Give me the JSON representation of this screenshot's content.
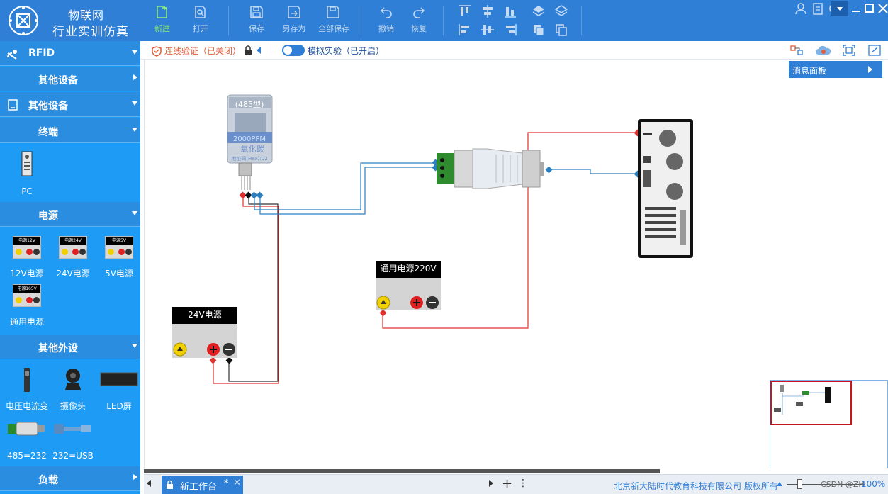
{
  "brand": {
    "line1": "物联网",
    "line2": "行业实训仿真"
  },
  "toolbar": {
    "new": "新建",
    "open": "打开",
    "save": "保存",
    "save_as": "另存为",
    "save_all": "全部保存",
    "undo": "撤销",
    "redo": "恢复"
  },
  "sidebar": {
    "rfid": "RFID",
    "other_devices_sub": "其他设备",
    "other_devices": "其他设备",
    "terminal": "终端",
    "pc": "PC",
    "power": "电源",
    "psu_12v": "12V电源",
    "psu_24v": "24V电源",
    "psu_5v": "5V电源",
    "psu_general": "通用电源",
    "psu_12v_top": "电源12V",
    "psu_24v_top": "电源24V",
    "psu_5v_top": "电源5V",
    "psu_general_top": "电源165V",
    "other_peripherals": "其他外设",
    "voltage_current": "电压电流变",
    "camera": "摄像头",
    "led": "LED屏",
    "conv_485": "485=232",
    "conv_232": "232=USB",
    "load": "负载"
  },
  "subbar": {
    "verify": "连线验证（已关闭）",
    "simulation": "模拟实验（已开启）"
  },
  "canvas": {
    "message_panel": "消息面板",
    "sensor_type": "(485型)",
    "sensor_value": "2000PPM",
    "sensor_name": "氧化碳",
    "sensor_addr": "地址码(Hex):02",
    "psu24_title": "24V电源",
    "psu220_title": "通用电源220V"
  },
  "bottom": {
    "tab": "新工作台",
    "tab_mark": "*",
    "copyright": "北京新大陆时代教育科技有限公司 版权所有",
    "zoom": "100%",
    "watermark": "CSDN @ZH"
  },
  "colors": {
    "primary": "#2f7fd6",
    "sidebar": "#1e9bf5",
    "wire_red": "#e03030",
    "wire_blue": "#2a7fc0"
  }
}
